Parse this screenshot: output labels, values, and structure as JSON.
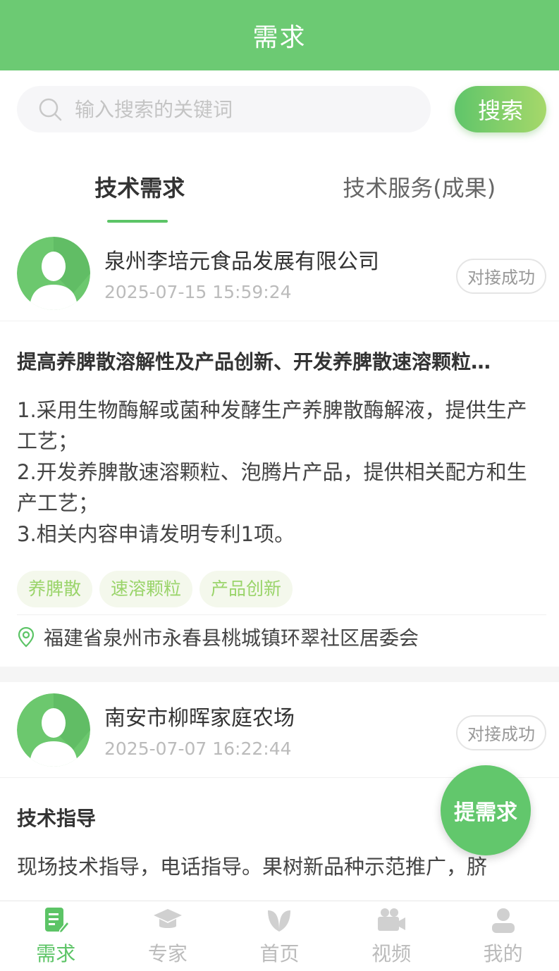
{
  "header": {
    "title": "需求"
  },
  "search": {
    "placeholder": "输入搜索的关键词",
    "button_label": "搜索"
  },
  "tabs": [
    {
      "label": "技术需求",
      "active": true
    },
    {
      "label": "技术服务(成果)",
      "active": false
    }
  ],
  "cards": [
    {
      "company": "泉州李培元食品发展有限公司",
      "time": "2025-07-15 15:59:24",
      "status": "对接成功",
      "title": "提高养脾散溶解性及产品创新、开发养脾散速溶颗粒…",
      "description": "1.采用生物酶解或菌种发酵生产养脾散酶解液，提供生产工艺；\n2.开发养脾散速溶颗粒、泡腾片产品，提供相关配方和生产工艺；\n3.相关内容申请发明专利1项。",
      "tags": [
        "养脾散",
        "速溶颗粒",
        "产品创新"
      ],
      "location": "福建省泉州市永春县桃城镇环翠社区居委会"
    },
    {
      "company": "南安市柳晖家庭农场",
      "time": "2025-07-07 16:22:44",
      "status": "对接成功",
      "title": "技术指导",
      "description": "现场技术指导，电话指导。果树新品种示范推广，脐"
    }
  ],
  "fab": {
    "label": "提需求"
  },
  "bottom_nav": [
    {
      "label": "需求",
      "icon": "document-edit-icon",
      "active": true
    },
    {
      "label": "专家",
      "icon": "graduation-cap-icon",
      "active": false
    },
    {
      "label": "首页",
      "icon": "leaf-icon",
      "active": false
    },
    {
      "label": "视频",
      "icon": "video-camera-icon",
      "active": false
    },
    {
      "label": "我的",
      "icon": "user-icon",
      "active": false
    }
  ],
  "colors": {
    "brand": "#6cca73",
    "accent": "#5cc466",
    "tag_text": "#9ad46a",
    "tag_bg": "#f4f8ec"
  }
}
